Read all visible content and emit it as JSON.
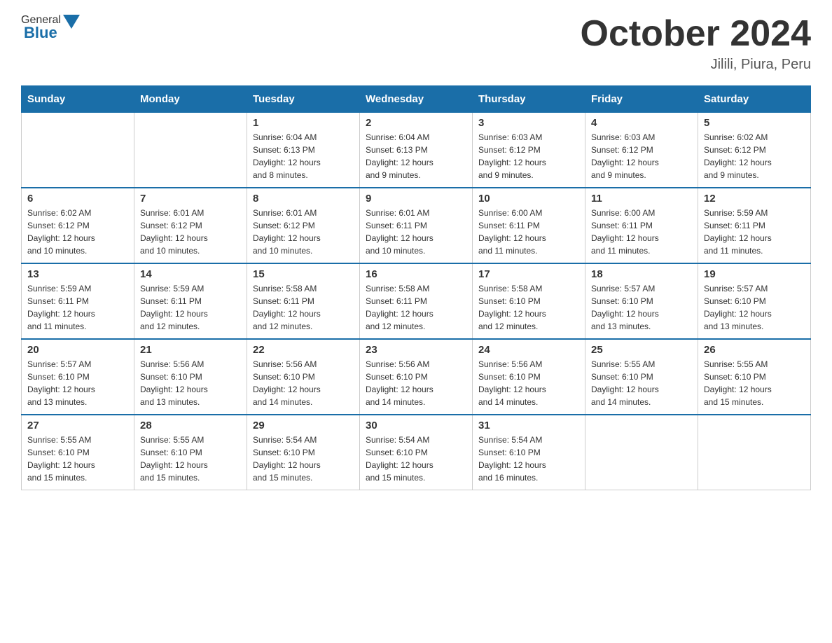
{
  "header": {
    "logo_general": "General",
    "logo_blue": "Blue",
    "month_title": "October 2024",
    "location": "Jilili, Piura, Peru"
  },
  "weekdays": [
    "Sunday",
    "Monday",
    "Tuesday",
    "Wednesday",
    "Thursday",
    "Friday",
    "Saturday"
  ],
  "weeks": [
    [
      {
        "day": "",
        "info": ""
      },
      {
        "day": "",
        "info": ""
      },
      {
        "day": "1",
        "info": "Sunrise: 6:04 AM\nSunset: 6:13 PM\nDaylight: 12 hours\nand 8 minutes."
      },
      {
        "day": "2",
        "info": "Sunrise: 6:04 AM\nSunset: 6:13 PM\nDaylight: 12 hours\nand 9 minutes."
      },
      {
        "day": "3",
        "info": "Sunrise: 6:03 AM\nSunset: 6:12 PM\nDaylight: 12 hours\nand 9 minutes."
      },
      {
        "day": "4",
        "info": "Sunrise: 6:03 AM\nSunset: 6:12 PM\nDaylight: 12 hours\nand 9 minutes."
      },
      {
        "day": "5",
        "info": "Sunrise: 6:02 AM\nSunset: 6:12 PM\nDaylight: 12 hours\nand 9 minutes."
      }
    ],
    [
      {
        "day": "6",
        "info": "Sunrise: 6:02 AM\nSunset: 6:12 PM\nDaylight: 12 hours\nand 10 minutes."
      },
      {
        "day": "7",
        "info": "Sunrise: 6:01 AM\nSunset: 6:12 PM\nDaylight: 12 hours\nand 10 minutes."
      },
      {
        "day": "8",
        "info": "Sunrise: 6:01 AM\nSunset: 6:12 PM\nDaylight: 12 hours\nand 10 minutes."
      },
      {
        "day": "9",
        "info": "Sunrise: 6:01 AM\nSunset: 6:11 PM\nDaylight: 12 hours\nand 10 minutes."
      },
      {
        "day": "10",
        "info": "Sunrise: 6:00 AM\nSunset: 6:11 PM\nDaylight: 12 hours\nand 11 minutes."
      },
      {
        "day": "11",
        "info": "Sunrise: 6:00 AM\nSunset: 6:11 PM\nDaylight: 12 hours\nand 11 minutes."
      },
      {
        "day": "12",
        "info": "Sunrise: 5:59 AM\nSunset: 6:11 PM\nDaylight: 12 hours\nand 11 minutes."
      }
    ],
    [
      {
        "day": "13",
        "info": "Sunrise: 5:59 AM\nSunset: 6:11 PM\nDaylight: 12 hours\nand 11 minutes."
      },
      {
        "day": "14",
        "info": "Sunrise: 5:59 AM\nSunset: 6:11 PM\nDaylight: 12 hours\nand 12 minutes."
      },
      {
        "day": "15",
        "info": "Sunrise: 5:58 AM\nSunset: 6:11 PM\nDaylight: 12 hours\nand 12 minutes."
      },
      {
        "day": "16",
        "info": "Sunrise: 5:58 AM\nSunset: 6:11 PM\nDaylight: 12 hours\nand 12 minutes."
      },
      {
        "day": "17",
        "info": "Sunrise: 5:58 AM\nSunset: 6:10 PM\nDaylight: 12 hours\nand 12 minutes."
      },
      {
        "day": "18",
        "info": "Sunrise: 5:57 AM\nSunset: 6:10 PM\nDaylight: 12 hours\nand 13 minutes."
      },
      {
        "day": "19",
        "info": "Sunrise: 5:57 AM\nSunset: 6:10 PM\nDaylight: 12 hours\nand 13 minutes."
      }
    ],
    [
      {
        "day": "20",
        "info": "Sunrise: 5:57 AM\nSunset: 6:10 PM\nDaylight: 12 hours\nand 13 minutes."
      },
      {
        "day": "21",
        "info": "Sunrise: 5:56 AM\nSunset: 6:10 PM\nDaylight: 12 hours\nand 13 minutes."
      },
      {
        "day": "22",
        "info": "Sunrise: 5:56 AM\nSunset: 6:10 PM\nDaylight: 12 hours\nand 14 minutes."
      },
      {
        "day": "23",
        "info": "Sunrise: 5:56 AM\nSunset: 6:10 PM\nDaylight: 12 hours\nand 14 minutes."
      },
      {
        "day": "24",
        "info": "Sunrise: 5:56 AM\nSunset: 6:10 PM\nDaylight: 12 hours\nand 14 minutes."
      },
      {
        "day": "25",
        "info": "Sunrise: 5:55 AM\nSunset: 6:10 PM\nDaylight: 12 hours\nand 14 minutes."
      },
      {
        "day": "26",
        "info": "Sunrise: 5:55 AM\nSunset: 6:10 PM\nDaylight: 12 hours\nand 15 minutes."
      }
    ],
    [
      {
        "day": "27",
        "info": "Sunrise: 5:55 AM\nSunset: 6:10 PM\nDaylight: 12 hours\nand 15 minutes."
      },
      {
        "day": "28",
        "info": "Sunrise: 5:55 AM\nSunset: 6:10 PM\nDaylight: 12 hours\nand 15 minutes."
      },
      {
        "day": "29",
        "info": "Sunrise: 5:54 AM\nSunset: 6:10 PM\nDaylight: 12 hours\nand 15 minutes."
      },
      {
        "day": "30",
        "info": "Sunrise: 5:54 AM\nSunset: 6:10 PM\nDaylight: 12 hours\nand 15 minutes."
      },
      {
        "day": "31",
        "info": "Sunrise: 5:54 AM\nSunset: 6:10 PM\nDaylight: 12 hours\nand 16 minutes."
      },
      {
        "day": "",
        "info": ""
      },
      {
        "day": "",
        "info": ""
      }
    ]
  ]
}
